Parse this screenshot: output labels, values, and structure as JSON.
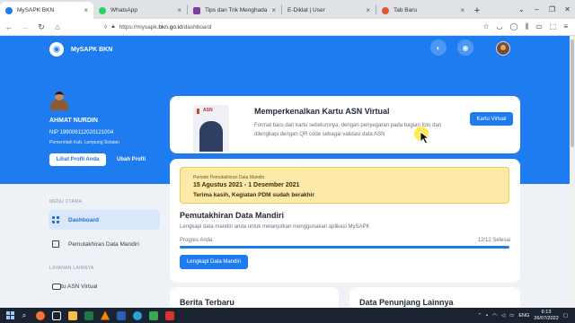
{
  "browser": {
    "tabs": [
      {
        "label": "MySAPK BKN",
        "active": true,
        "favicon": "#1f7cf0"
      },
      {
        "label": "WhatsApp",
        "active": false,
        "favicon": "#25d366"
      },
      {
        "label": "Tips dan Trik Menghadapi Ujian",
        "active": false,
        "favicon": "#7d3c98"
      },
      {
        "label": "E-Diklat | User",
        "active": false,
        "favicon": "#ffffff"
      },
      {
        "label": "Tab Baru",
        "active": false,
        "favicon": "#e4572e"
      }
    ],
    "url_prefix": "https://mysapk.",
    "url_host": "bkn.go.id",
    "url_path": "/dashboard"
  },
  "app": {
    "name": "MySAPK BKN"
  },
  "profile": {
    "name": "AHMAT NURDIN",
    "nip": "NIP 199006112020121004",
    "unit": "Pemerintah Kab. Lampung Selatan",
    "view_button": "Lihat Profil Anda",
    "edit_button": "Ubah Profil"
  },
  "sidebar": {
    "group1": "MENU UTAMA",
    "items1": [
      {
        "label": "Dashboard",
        "icon": "dashboard-icon",
        "active": true
      },
      {
        "label": "Pemutakhiran Data Mandiri",
        "icon": "grid-icon",
        "active": false
      }
    ],
    "group2": "LAYANAN LAINNYA",
    "items2": [
      {
        "label": "Kartu ASN Virtual",
        "icon": "card-icon",
        "active": false
      }
    ]
  },
  "promo": {
    "image_label": "ASN",
    "title": "Memperkenalkan Kartu ASN Virtual",
    "desc": "Format baru dari kartu sebelumnya, dengan penyegaran pada bagian foto dan dilengkapi dengan QR code sebagai validasi data ASN",
    "button": "Kartu Virtual"
  },
  "update": {
    "period_label": "Periode Pemutakhiran Data Mandiri",
    "period_dates": "15 Agustus 2021 - 1 Desember 2021",
    "period_note": "Terima kasih, Kegiatan PDM sudah berakhir",
    "title": "Pemutakhiran Data Mandiri",
    "desc": "Lengkapi data mandiri anda untuk melanjutkan menggunakan aplikasi MySAPK",
    "progress_label": "Progres Anda",
    "progress_value": "12/12 Selesai",
    "progress_fraction": 1.0,
    "button": "Lengkapi Data Mandiri"
  },
  "news": {
    "title": "Berita Terbaru"
  },
  "docs": {
    "title": "Data Penunjang Lainnya"
  },
  "taskbar": {
    "lang": "ENG",
    "time": "6:13",
    "date": "26/07/2022"
  },
  "colors": {
    "brand": "#1f7cf0",
    "warning_bg": "#fde9a8"
  }
}
